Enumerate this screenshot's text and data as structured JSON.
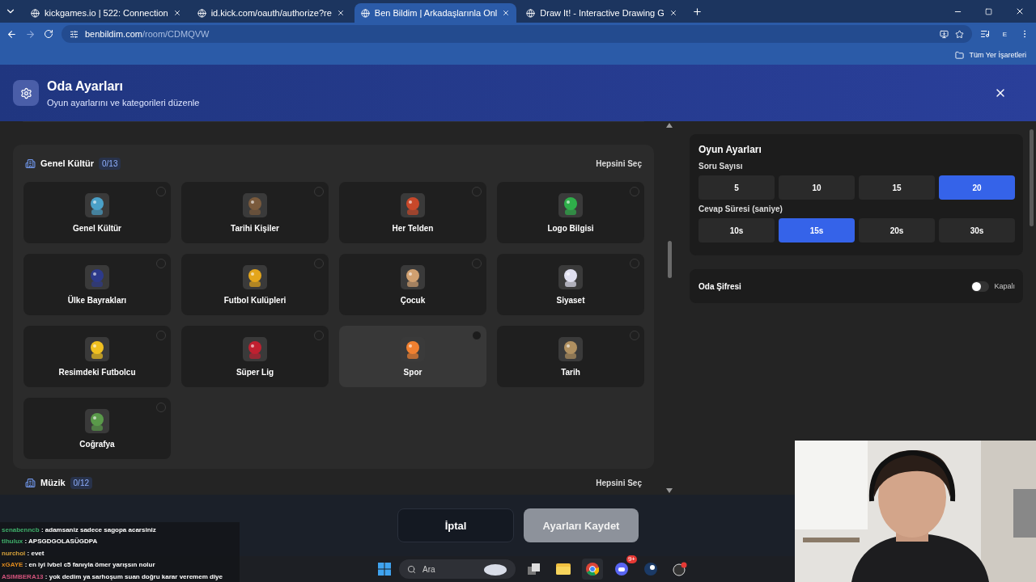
{
  "browser": {
    "tabs": [
      {
        "title": "kickgames.io | 522: Connection",
        "selected": false
      },
      {
        "title": "id.kick.com/oauth/authorize?re",
        "selected": false
      },
      {
        "title": "Ben Bildim | Arkadaşlarınla Onl",
        "selected": true
      },
      {
        "title": "Draw It! - Interactive Drawing G",
        "selected": false
      }
    ],
    "url": {
      "host": "benbildim.com",
      "path": "/room/CDMQVW"
    },
    "profile": "E",
    "bookmarks_label": "Tüm Yer İşaretleri"
  },
  "dialog": {
    "title": "Oda Ayarları",
    "subtitle": "Oyun ayarlarını ve kategorileri düzenle"
  },
  "sections": [
    {
      "title": "Genel Kültür",
      "count": "0/13",
      "select_all": "Hepsini Seç",
      "tiles": [
        {
          "label": "Genel Kültür",
          "selected": false,
          "hovered": false
        },
        {
          "label": "Tarihi Kişiler",
          "selected": false,
          "hovered": false
        },
        {
          "label": "Her Telden",
          "selected": false,
          "hovered": false
        },
        {
          "label": "Logo Bilgisi",
          "selected": false,
          "hovered": false
        },
        {
          "label": "Ülke Bayrakları",
          "selected": false,
          "hovered": false
        },
        {
          "label": "Futbol Kulüpleri",
          "selected": false,
          "hovered": false
        },
        {
          "label": "Çocuk",
          "selected": false,
          "hovered": false
        },
        {
          "label": "Siyaset",
          "selected": false,
          "hovered": false
        },
        {
          "label": "Resimdeki Futbolcu",
          "selected": false,
          "hovered": false
        },
        {
          "label": "Süper Lig",
          "selected": false,
          "hovered": false
        },
        {
          "label": "Spor",
          "selected": false,
          "hovered": true
        },
        {
          "label": "Tarih",
          "selected": false,
          "hovered": false
        },
        {
          "label": "Coğrafya",
          "selected": false,
          "hovered": false
        }
      ]
    },
    {
      "title": "Müzik",
      "count": "0/12",
      "select_all": "Hepsini Seç"
    }
  ],
  "game_settings": {
    "title": "Oyun Ayarları",
    "groups": [
      {
        "label": "Soru Sayısı",
        "options": [
          {
            "label": "5",
            "selected": false
          },
          {
            "label": "10",
            "selected": false
          },
          {
            "label": "15",
            "selected": false
          },
          {
            "label": "20",
            "selected": true
          }
        ]
      },
      {
        "label": "Cevap Süresi (saniye)",
        "options": [
          {
            "label": "10s",
            "selected": false
          },
          {
            "label": "15s",
            "selected": true
          },
          {
            "label": "20s",
            "selected": false
          },
          {
            "label": "30s",
            "selected": false
          }
        ]
      }
    ]
  },
  "password": {
    "label": "Oda Şifresi",
    "on": false,
    "state_label": "Kapalı"
  },
  "footer": {
    "cancel": "İptal",
    "save": "Ayarları Kaydet"
  },
  "chat": [
    {
      "user": "senabenncb",
      "color": "#3fae6a",
      "message": ": adamsaniz sadece sagopa acarsiniz"
    },
    {
      "user": "tlhulux",
      "color": "#3fae6a",
      "message": ": APSGDGOLASÜGDPA"
    },
    {
      "user": "nurchoi",
      "color": "#d4a03a",
      "message": ": evet"
    },
    {
      "user": "xGAYE",
      "color": "#e08a1e",
      "message": ": en iyi lvbel c5 fanıyla ömer yarışsın nolur"
    },
    {
      "user": "ASIMBERA13",
      "color": "#d0527a",
      "message": ": yok dedim ya sarhoşum suan doğru karar veremem diye"
    }
  ],
  "taskbar": {
    "search_placeholder": "Ara",
    "discord_badge": "9+"
  }
}
